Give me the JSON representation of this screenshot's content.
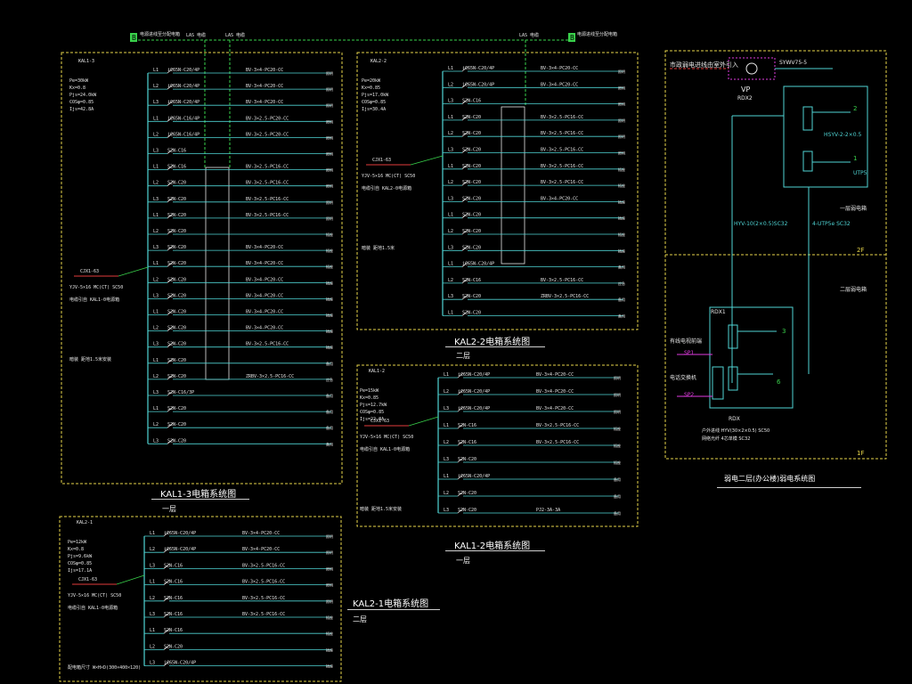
{
  "header": {
    "top_left_box": "B",
    "top_left_note": "电源进线至分配电箱",
    "cable_label_1": "LAS 电缆",
    "cable_label_2": "LAS 电缆",
    "cable_label_3": "LAS 电缆",
    "top_right_box": "B",
    "top_right_note": "电源进线至分配电箱"
  },
  "panels": {
    "kal13": {
      "title": "KAL1-3电箱系统图",
      "floor": "一层",
      "box_id": "KAL1-3",
      "params": [
        "Pe=30kW",
        "Kx=0.8",
        "Pjs=24.0kW",
        "COSφ=0.85",
        "Ijs=42.8A"
      ],
      "incoming": "CJX1-63",
      "cable": "YJV-5×16 MC(CT) SC50",
      "source": "电缆引自 KAL1-0电源箱",
      "note": "暗装 距地1.5米安装",
      "circuits": [
        "L1",
        "L2",
        "L3",
        "L1",
        "L2",
        "L3",
        "L1",
        "L2",
        "L3",
        "L1",
        "L2",
        "L3",
        "L1",
        "L2",
        "L3",
        "L1",
        "L2",
        "L3",
        "L1",
        "L2",
        "L3",
        "L1",
        "L2",
        "L3"
      ],
      "breakers": [
        "iC65N-C20/4P",
        "iC65N-C20/4P",
        "iC65N-C20/4P",
        "iC65N-C16/4P",
        "iC65N-C16/4P",
        "S2N-C16",
        "S2N-C16",
        "S2N-C20",
        "S2N-C20",
        "S2N-C20",
        "S2N-C20",
        "S2N-C20",
        "S2N-C20",
        "S2N-C20",
        "S2N-C20",
        "S2N-C20",
        "S2N-C20",
        "S2N-C20",
        "S2N-C20",
        "S2N-C20",
        "S2N-C16/3P",
        "S2N-C20",
        "S2N-C20",
        "S2N-C20"
      ],
      "wires": [
        "BV-3×4-PC20-CC",
        "BV-3×4-PC20-CC",
        "BV-3×4-PC20-CC",
        "BV-3×2.5-PC20-CC",
        "BV-3×2.5-PC20-CC",
        "",
        "BV-3×2.5-PC16-CC",
        "BV-3×2.5-PC16-CC",
        "BV-3×2.5-PC16-CC",
        "BV-3×2.5-PC16-CC",
        "",
        "BV-3×4-PC20-CC",
        "BV-3×4-PC20-CC",
        "BV-3×4-PC20-CC",
        "BV-3×4-PC20-CC",
        "BV-3×4-PC20-CC",
        "BV-3×4-PC20-CC",
        "BV-3×2.5-PC16-CC",
        "",
        "ZRBV-3×2.5-PC16-CC",
        "",
        "",
        "",
        ""
      ],
      "loads": [
        "照明",
        "照明",
        "照明",
        "照明",
        "照明",
        "照明",
        "照明",
        "照明",
        "照明",
        "照明",
        "插座",
        "插座",
        "插座",
        "插座",
        "插座",
        "插座",
        "插座",
        "插座",
        "备用",
        "应急",
        "备用",
        "备用",
        "备用",
        "备用"
      ]
    },
    "kal22": {
      "title": "KAL2-2电箱系统图",
      "floor": "二层",
      "box_id": "KAL2-2",
      "params": [
        "Pe=20kW",
        "Kx=0.85",
        "Pjs=17.0kW",
        "COSφ=0.85",
        "Ijs=30.4A"
      ],
      "incoming": "CJX1-63",
      "cable": "YJV-5×16 MC(CT) SC50",
      "source": "电缆引自 KAL2-0电源箱",
      "note": "暗装 距地1.5米",
      "circuits": [
        "L1",
        "L2",
        "L3",
        "L1",
        "L2",
        "L3",
        "L1",
        "L2",
        "L3",
        "L1",
        "L2",
        "L3",
        "L1",
        "L2",
        "L3",
        "L1"
      ],
      "breakers": [
        "iC65N-C20/4P",
        "iC65N-C20/4P",
        "S2N-C16",
        "S2N-C20",
        "S2N-C20",
        "S2N-C20",
        "S2N-C20",
        "S2N-C20",
        "S2N-C20",
        "S2N-C20",
        "S2N-C20",
        "S2N-C20",
        "iC65N-C20/4P",
        "S2N-C16",
        "S2N-C20",
        "S2N-C20"
      ],
      "wires": [
        "BV-3×4-PC20-CC",
        "BV-3×4-PC20-CC",
        "",
        "BV-3×2.5-PC16-CC",
        "BV-3×2.5-PC16-CC",
        "BV-3×2.5-PC16-CC",
        "BV-3×2.5-PC16-CC",
        "BV-3×2.5-PC16-CC",
        "BV-3×4-PC20-CC",
        "",
        "",
        "",
        "",
        "BV-3×2.5-PC16-CC",
        "ZRBV-3×2.5-PC16-CC",
        ""
      ],
      "loads": [
        "照明",
        "照明",
        "照明",
        "照明",
        "照明",
        "照明",
        "插座",
        "插座",
        "插座",
        "插座",
        "插座",
        "插座",
        "备用",
        "应急",
        "备用",
        "备用"
      ]
    },
    "kal12": {
      "title": "KAL1-2电箱系统图",
      "floor": "一层",
      "box_id": "KAL1-2",
      "params": [
        "Pe=15kW",
        "Kx=0.85",
        "Pjs=12.7kW",
        "COSφ=0.85",
        "Ijs=22.8A"
      ],
      "incoming": "CJX1-63",
      "cable": "YJV-5×16 MC(CT) SC50",
      "source": "电缆引自 KAL1-0电源箱",
      "note": "暗装 距地1.5米安装",
      "circuits": [
        "L1",
        "L2",
        "L3",
        "L1",
        "L2",
        "L3",
        "L1",
        "L2",
        "L3"
      ],
      "breakers": [
        "iC65N-C20/4P",
        "iC65N-C20/4P",
        "iC65N-C20/4P",
        "S2N-C16",
        "S2N-C16",
        "S2N-C20",
        "iC65N-C20/4P",
        "S2N-C20",
        "S2N-C20"
      ],
      "wires": [
        "BV-3×4-PC20-CC",
        "BV-3×4-PC20-CC",
        "BV-3×4-PC20-CC",
        "BV-3×2.5-PC16-CC",
        "BV-3×2.5-PC16-CC",
        "",
        "",
        "",
        "PJ2-3A-3A"
      ],
      "loads": [
        "照明",
        "照明",
        "照明",
        "插座",
        "插座",
        "插座",
        "备用",
        "备用",
        "备用"
      ]
    },
    "kal21": {
      "title": "KAL2-1电箱系统图",
      "floor": "二层",
      "box_id": "KAL2-1",
      "params": [
        "Pe=12kW",
        "Kx=0.8",
        "Pjs=9.6kW",
        "COSφ=0.85",
        "Ijs=17.1A"
      ],
      "incoming": "CJX1-63",
      "cable": "YJV-5×16 MC(CT) SC50",
      "source": "电缆引自 KAL1-0电源箱",
      "note": "配电箱尺寸 W×H×D(300×400×120)",
      "circuits": [
        "L1",
        "L2",
        "L3",
        "L1",
        "L2",
        "L3",
        "L1",
        "L2",
        "L3"
      ],
      "breakers": [
        "iC65N-C20/4P",
        "iC65N-C20/4P",
        "S2N-C16",
        "S2N-C16",
        "S2N-C16",
        "S2N-C16",
        "S2N-C16",
        "S2N-C20",
        "iC65N-C20/4P"
      ],
      "wires": [
        "BV-3×4-PC20-CC",
        "BV-3×4-PC20-CC",
        "BV-3×2.5-PC16-CC",
        "BV-3×2.5-PC16-CC",
        "BV-3×2.5-PC16-CC",
        "BV-3×2.5-PC16-CC",
        "",
        "",
        ""
      ],
      "loads": [
        "照明",
        "照明",
        "照明",
        "照明",
        "照明",
        "插座",
        "插座",
        "插座",
        "插座"
      ]
    },
    "weak": {
      "title": "弱电二层(办公楼)弱电系统图",
      "top_note": "市政弱电进线由室外引入",
      "vp": "VP",
      "rdx2": "RDX2",
      "rdx1": "RDX1",
      "rdx": "RDX",
      "floor2": "2F",
      "floor1": "1F",
      "mid_label": "二层弱电箱",
      "mid_label2": "一层弱电箱",
      "cable1": "SYWV75-5",
      "cable2": "HSYV-2-2×0.5",
      "cable3": "UTP5",
      "riser1": "HYV-10(2×0.5)SC32",
      "riser2": "4-UTP5e SC32",
      "tv_label": "有线电视前端",
      "tel_label": "电话交换机",
      "sp1": "SP1",
      "sp2": "SP2",
      "n1": "1",
      "n2": "2",
      "n3": "3",
      "n4": "6",
      "foot1": "户外进线 HYV(30×2×0.5) SC50",
      "foot2": "网络光纤 4芯单模 SC32"
    }
  },
  "colors": {
    "yellow": "#e6d54a",
    "cyan": "#4fd4d4",
    "green": "#39d24b",
    "white": "#e8e8e8",
    "red": "#e23b3b",
    "magenta": "#e03be0"
  }
}
